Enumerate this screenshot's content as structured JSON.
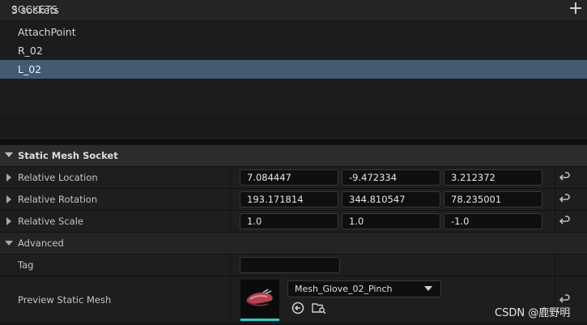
{
  "sockets": {
    "title": "SOCKETS",
    "add_label": "+",
    "items": [
      "AttachPoint",
      "R_02",
      "L_02"
    ],
    "selected": "L_02",
    "count_text": "3 sockets"
  },
  "details": {
    "section_title": "Static Mesh Socket",
    "location": {
      "label": "Relative Location",
      "x": "7.084447",
      "y": "-9.472334",
      "z": "3.212372"
    },
    "rotation": {
      "label": "Relative Rotation",
      "x": "193.171814",
      "y": "344.810547",
      "z": "78.235001"
    },
    "scale": {
      "label": "Relative Scale",
      "x": "1.0",
      "y": "1.0",
      "z": "-1.0"
    },
    "advanced_label": "Advanced",
    "tag": {
      "label": "Tag",
      "value": ""
    },
    "preview": {
      "label": "Preview Static Mesh",
      "mesh_name": "Mesh_Glove_02_Pinch"
    }
  },
  "watermark": "CSDN @鹿野明",
  "colors": {
    "selection": "#435a73",
    "thumb_accent": "#35c4c9"
  }
}
